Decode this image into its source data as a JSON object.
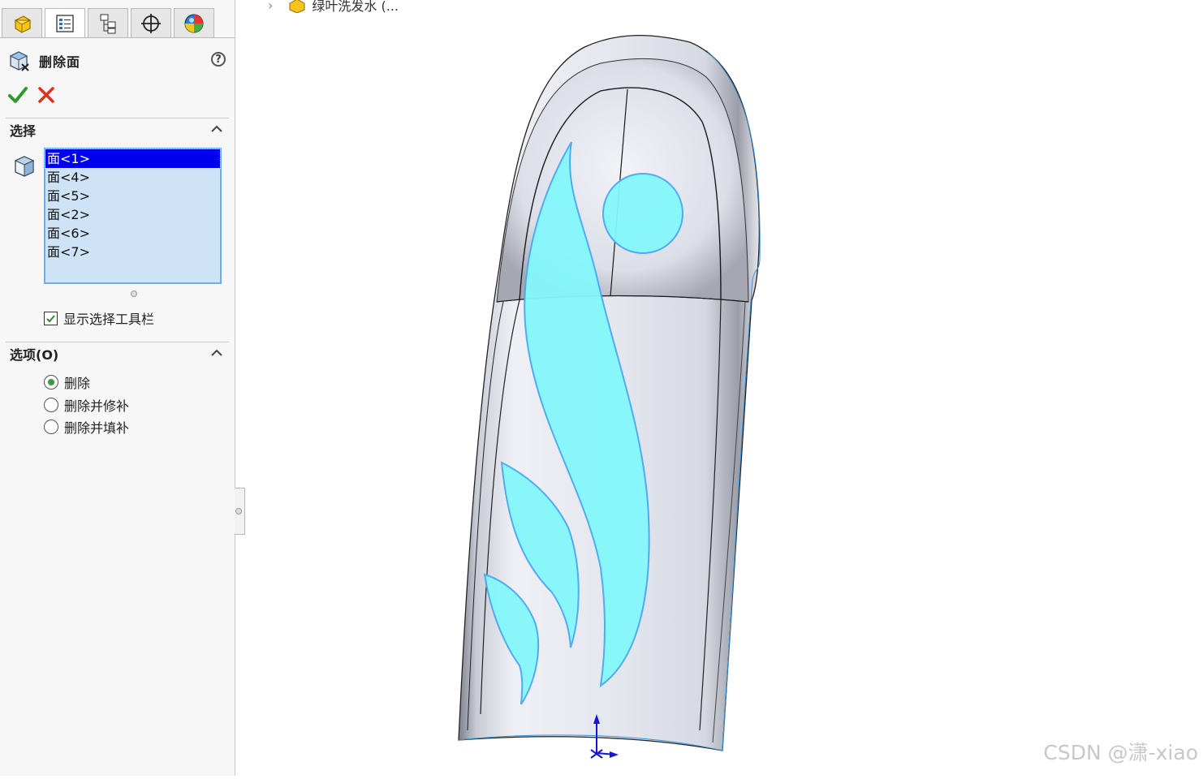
{
  "property_manager": {
    "tabs": [
      {
        "icon": "feature-manager-icon"
      },
      {
        "icon": "property-manager-icon"
      },
      {
        "icon": "configuration-manager-icon"
      },
      {
        "icon": "dimxpert-manager-icon"
      },
      {
        "icon": "display-manager-icon"
      }
    ],
    "title": "删除面",
    "help_icon": "help-icon",
    "ok_icon": "green-checkmark-icon",
    "cancel_icon": "red-x-icon",
    "selection": {
      "heading": "选择",
      "faces": [
        "面<1>",
        "面<4>",
        "面<5>",
        "面<2>",
        "面<6>",
        "面<7>"
      ],
      "selected_index": 0,
      "show_toolbar_label": "显示选择工具栏",
      "show_toolbar_checked": true
    },
    "options": {
      "heading": "选项(O)",
      "radios": [
        {
          "label": "删除",
          "checked": true
        },
        {
          "label": "删除并修补",
          "checked": false
        },
        {
          "label": "删除并填补",
          "checked": false
        }
      ]
    }
  },
  "viewport": {
    "tree_item_label": "绿叶洗发水 (...",
    "watermark": "CSDN @潇-xiao",
    "colors": {
      "highlight_face": "#84f8fb",
      "highlight_edge": "#4aa8f0",
      "accent": "#0000ee"
    }
  }
}
